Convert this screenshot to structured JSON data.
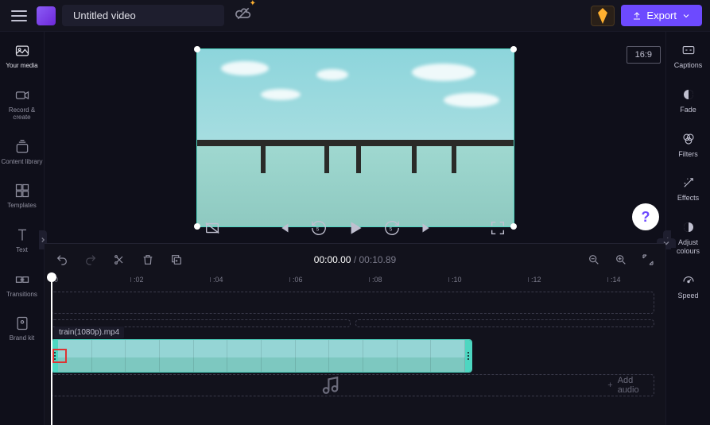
{
  "header": {
    "title": "Untitled video",
    "export_label": "Export"
  },
  "left_sidebar": {
    "items": [
      {
        "label": "Your media"
      },
      {
        "label": "Record & create"
      },
      {
        "label": "Content library"
      },
      {
        "label": "Templates"
      },
      {
        "label": "Text"
      },
      {
        "label": "Transitions"
      },
      {
        "label": "Brand kit"
      }
    ]
  },
  "right_sidebar": {
    "items": [
      {
        "label": "Captions"
      },
      {
        "label": "Fade"
      },
      {
        "label": "Filters"
      },
      {
        "label": "Effects"
      },
      {
        "label": "Adjust colours"
      },
      {
        "label": "Speed"
      }
    ]
  },
  "preview": {
    "aspect_ratio": "16:9"
  },
  "playback": {
    "current_time": "00:00.00",
    "duration": "00:10.89"
  },
  "ruler": {
    "marks": [
      "0",
      ":02",
      ":04",
      ":06",
      ":08",
      ":10",
      ":12",
      ":14"
    ]
  },
  "clip": {
    "filename": "train(1080p).mp4"
  },
  "audio_track": {
    "placeholder": "Add audio"
  },
  "help": {
    "label": "?"
  }
}
